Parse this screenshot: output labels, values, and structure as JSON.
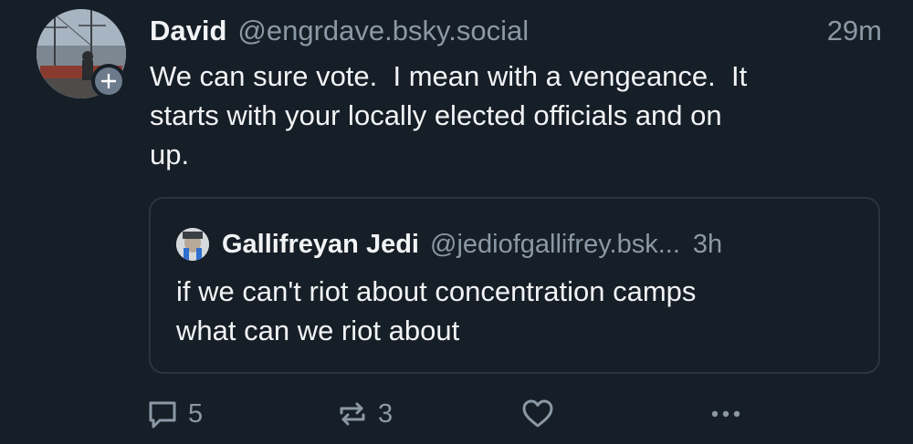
{
  "post": {
    "author_name": "David",
    "author_handle": "@engrdave.bsky.social",
    "time": "29m",
    "text": "We can sure vote.  I mean with a vengeance.  It\nstarts with your locally elected officials and on\nup."
  },
  "quote": {
    "author_name": "Gallifreyan Jedi",
    "author_handle": "@jediofgallifrey.bsk...",
    "time": "3h",
    "text": "if we can't riot about concentration camps\nwhat can we riot about"
  },
  "actions": {
    "reply_count": "5",
    "repost_count": "3"
  },
  "colors": {
    "background": "#161e27",
    "text_primary": "#f1f3f5",
    "text_secondary": "#8b98a5",
    "border": "#2b3540"
  },
  "icons": {
    "reply": "speech-bubble-icon",
    "repost": "repost-arrows-icon",
    "like": "heart-icon",
    "more": "ellipsis-icon",
    "follow": "plus-icon"
  }
}
